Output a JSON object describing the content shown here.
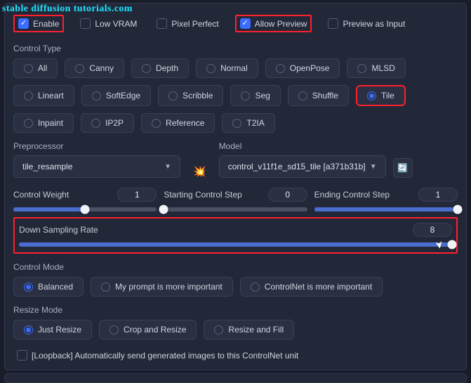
{
  "watermark": "stable diffusion tutorials.com",
  "checkboxes": {
    "enable": {
      "label": "Enable",
      "checked": true
    },
    "low_vram": {
      "label": "Low VRAM",
      "checked": false
    },
    "pixel_perfect": {
      "label": "Pixel Perfect",
      "checked": false
    },
    "allow_preview": {
      "label": "Allow Preview",
      "checked": true
    },
    "preview_input": {
      "label": "Preview as Input",
      "checked": false
    }
  },
  "control_type": {
    "label": "Control Type",
    "options": [
      "All",
      "Canny",
      "Depth",
      "Normal",
      "OpenPose",
      "MLSD",
      "Lineart",
      "SoftEdge",
      "Scribble",
      "Seg",
      "Shuffle",
      "Tile",
      "Inpaint",
      "IP2P",
      "Reference",
      "T2IA"
    ],
    "selected": "Tile"
  },
  "preprocessor": {
    "label": "Preprocessor",
    "value": "tile_resample"
  },
  "model": {
    "label": "Model",
    "value": "control_v11f1e_sd15_tile [a371b31b]"
  },
  "sliders": {
    "control_weight": {
      "label": "Control Weight",
      "value": "1",
      "pct": 50
    },
    "start_step": {
      "label": "Starting Control Step",
      "value": "0",
      "pct": 0
    },
    "end_step": {
      "label": "Ending Control Step",
      "value": "1",
      "pct": 100
    },
    "down_sampling": {
      "label": "Down Sampling Rate",
      "value": "8",
      "pct": 100
    }
  },
  "control_mode": {
    "label": "Control Mode",
    "options": [
      "Balanced",
      "My prompt is more important",
      "ControlNet is more important"
    ],
    "selected": "Balanced"
  },
  "resize_mode": {
    "label": "Resize Mode",
    "options": [
      "Just Resize",
      "Crop and Resize",
      "Resize and Fill"
    ],
    "selected": "Just Resize"
  },
  "loopback": {
    "label": "[Loopback] Automatically send generated images to this ControlNet unit",
    "checked": false
  },
  "glyphs": {
    "check": "✓",
    "caret": "▼",
    "bomb": "💥",
    "refresh": "🔄",
    "cursor": "➤"
  }
}
